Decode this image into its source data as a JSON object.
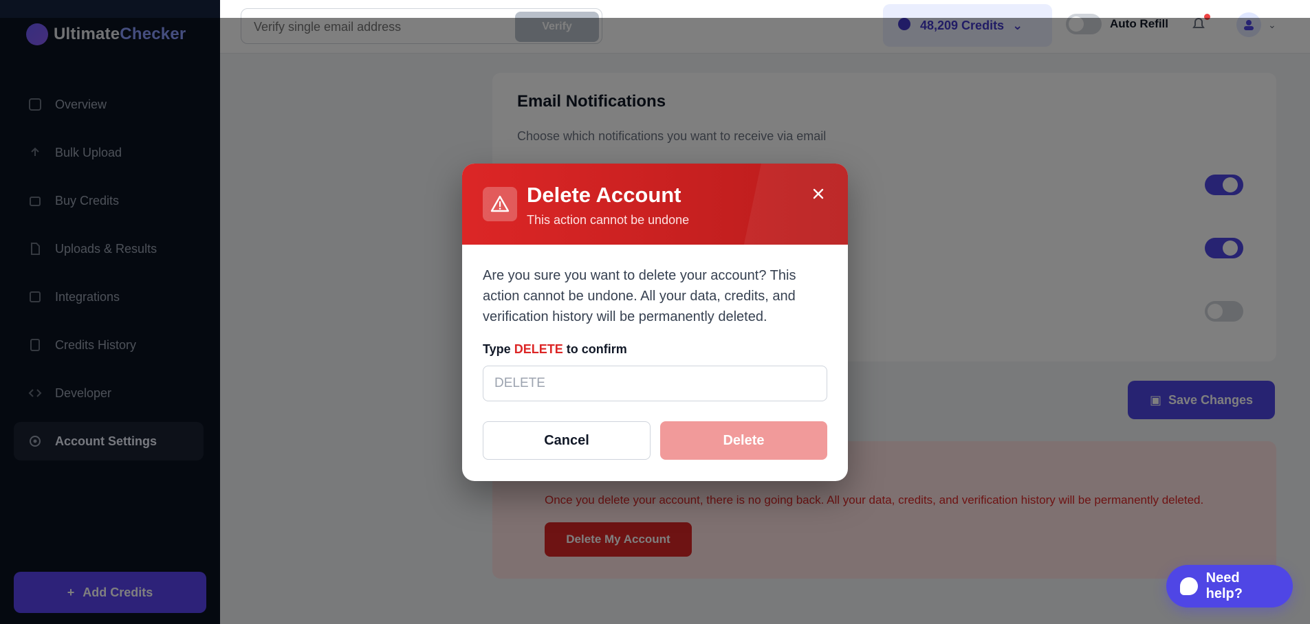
{
  "app": {
    "logo_text_pre": "Ultimate",
    "logo_text_post": "Checker"
  },
  "sidebar": {
    "items": [
      {
        "label": "Overview",
        "icon": "grid-icon"
      },
      {
        "label": "Bulk Upload",
        "icon": "upload-icon"
      },
      {
        "label": "Buy Credits",
        "icon": "cart-icon"
      },
      {
        "label": "Uploads & Results",
        "icon": "file-icon"
      },
      {
        "label": "Integrations",
        "icon": "plug-icon"
      },
      {
        "label": "Credits History",
        "icon": "history-icon"
      },
      {
        "label": "Developer",
        "icon": "code-icon"
      },
      {
        "label": "Account Settings",
        "icon": "gear-icon",
        "active": true
      }
    ],
    "add_credits_label": "Add Credits"
  },
  "topbar": {
    "search_placeholder": "Verify single email address",
    "verify_label": "Verify",
    "credits_label": "48,209 Credits",
    "auto_refill_label": "Auto Refill"
  },
  "content": {
    "section_title": "Email Notifications",
    "section_subtitle": "Choose which notifications you want to receive via email",
    "save_label": "Save Changes",
    "danger_text": "Once you delete your account, there is no going back. All your data, credits, and verification history will be permanently deleted.",
    "danger_button_label": "Delete My Account"
  },
  "modal": {
    "title": "Delete Account",
    "subtitle": "This action cannot be undone",
    "body": "Are you sure you want to delete your account? This action cannot be undone. All your data, credits, and verification history will be permanently deleted.",
    "confirm_prefix": "Type",
    "confirm_keyword": "DELETE",
    "confirm_suffix": "to confirm",
    "input_placeholder": "DELETE",
    "cancel_label": "Cancel",
    "delete_label": "Delete"
  },
  "help": {
    "label": "Need help?"
  },
  "colors": {
    "danger": "#dc2626",
    "accent": "#4f46e5",
    "sidebar_bg": "#0b1220"
  }
}
